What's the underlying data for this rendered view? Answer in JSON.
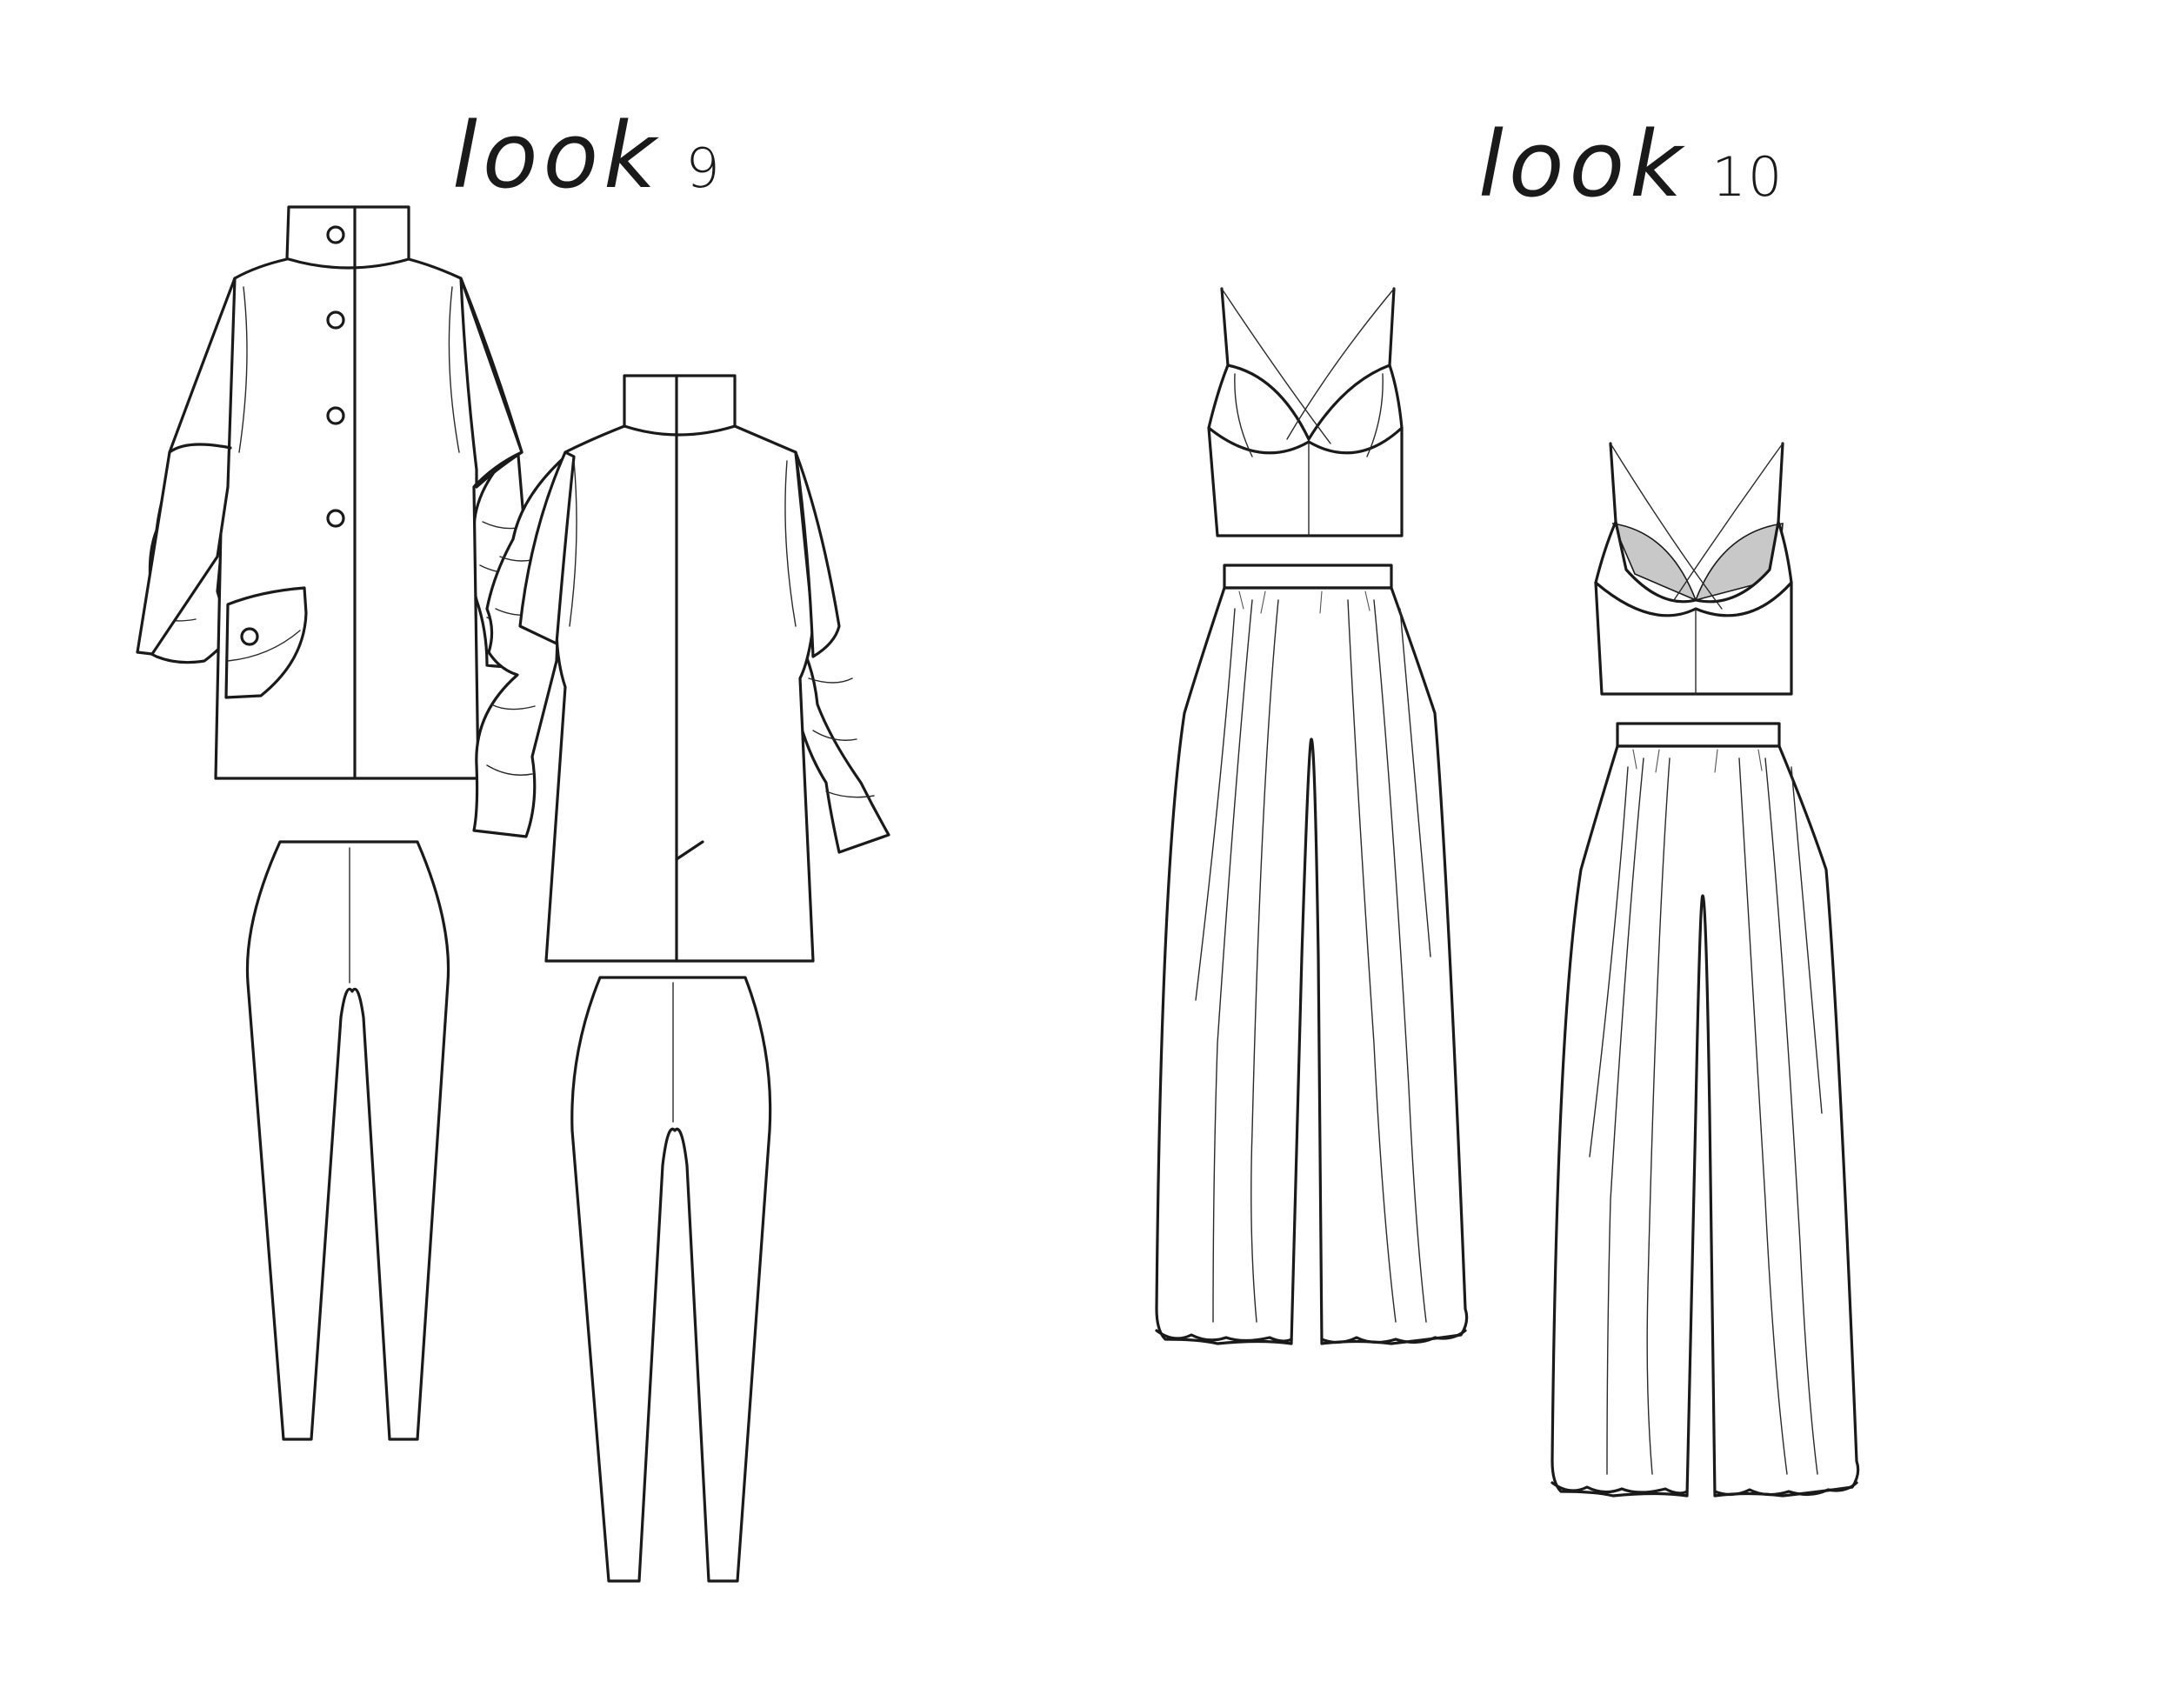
{
  "looks": [
    {
      "id": "look9",
      "label": "look",
      "number": "9"
    },
    {
      "id": "look10",
      "label": "look",
      "number": "10"
    }
  ],
  "colors": {
    "line": "#1a1a1a",
    "fill": "#ffffff",
    "shade": "#c8c8c8"
  }
}
